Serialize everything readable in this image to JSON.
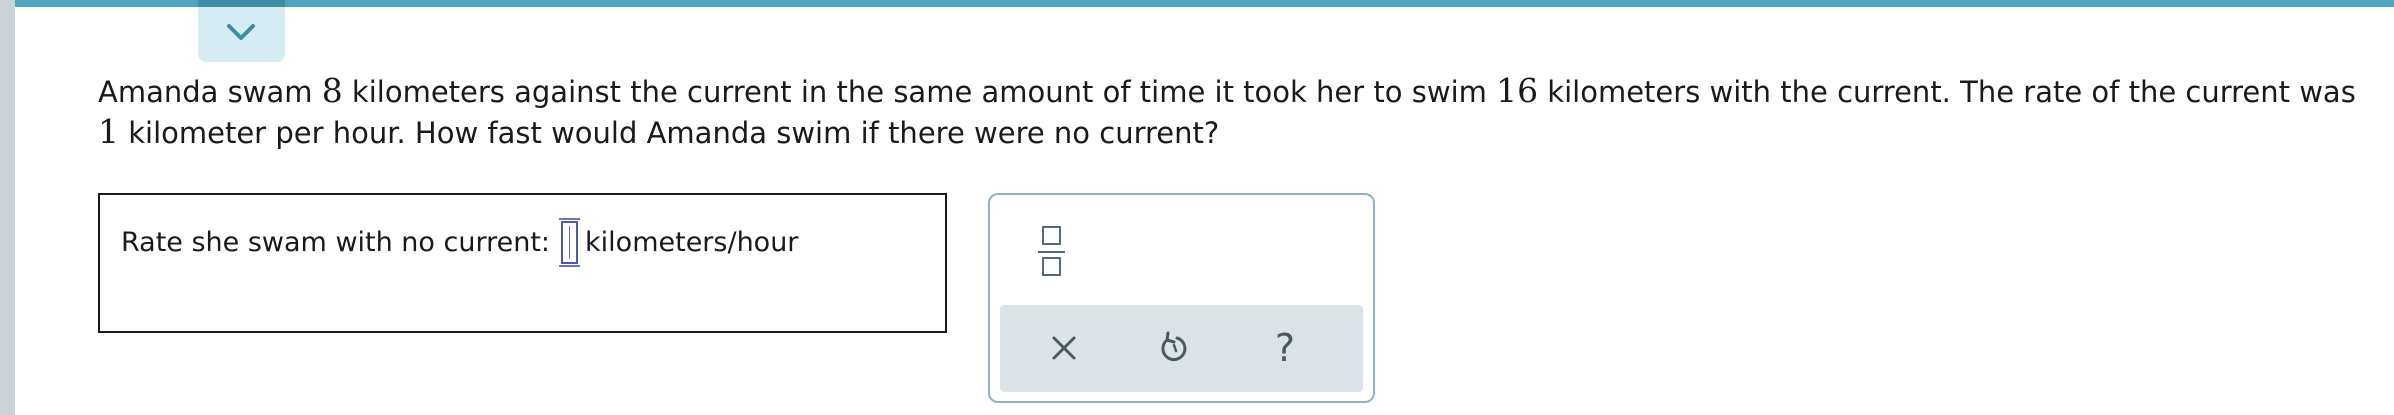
{
  "header": {
    "collapse_icon": "chevron-down-icon",
    "accent_color": "#4fa3bd"
  },
  "question": {
    "part1": "Amanda swam ",
    "num1": "8",
    "part2": " kilometers against the current in the same amount of time it took her to swim ",
    "num2": "16",
    "part3": " kilometers with the current. The rate of the current was ",
    "num3": "1",
    "part4": " kilometer per hour. How fast would Amanda swim if there were no current?"
  },
  "answer": {
    "label": "Rate she swam with no current:",
    "value": "",
    "unit": "kilometers/hour"
  },
  "tools": {
    "fraction_icon": "fraction-template-icon",
    "clear_icon": "close-icon",
    "undo_icon": "undo-icon",
    "help_icon": "question-mark-icon",
    "help_glyph": "?"
  }
}
